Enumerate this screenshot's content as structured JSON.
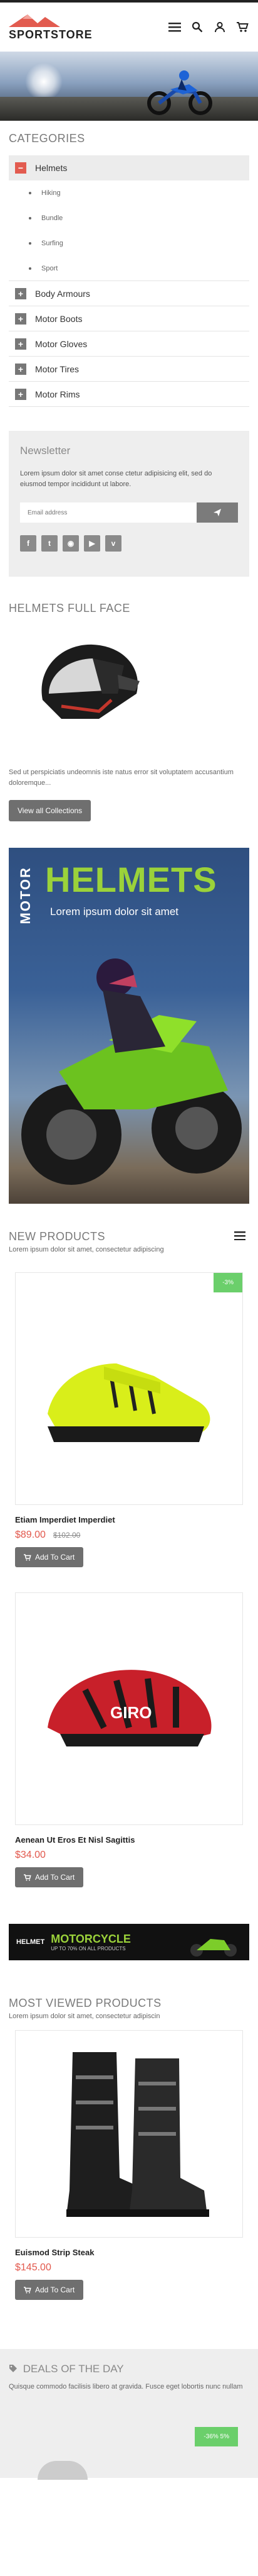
{
  "brand": {
    "name": "SPORTSTORE",
    "accent": "#e25b4f"
  },
  "header_icons": [
    "menu-icon",
    "search-icon",
    "user-icon",
    "cart-icon"
  ],
  "categories": {
    "title": "CATEGORIES",
    "active": {
      "label": "Helmets",
      "toggle": "−"
    },
    "subs": [
      "Hiking",
      "Bundle",
      "Surfing",
      "Sport"
    ],
    "items": [
      {
        "label": "Body Armours",
        "toggle": "+"
      },
      {
        "label": "Motor Boots",
        "toggle": "+"
      },
      {
        "label": "Motor Gloves",
        "toggle": "+"
      },
      {
        "label": "Motor Tires",
        "toggle": "+"
      },
      {
        "label": "Motor Rims",
        "toggle": "+"
      }
    ]
  },
  "newsletter": {
    "title": "Newsletter",
    "text": "Lorem ipsum dolor sit amet conse ctetur adipisicing elit, sed do eiusmod tempor incididunt ut labore.",
    "placeholder": "Email address",
    "social": [
      "facebook-icon",
      "twitter-icon",
      "rss-icon",
      "youtube-icon",
      "vimeo-icon"
    ]
  },
  "helmets_full_face": {
    "title": "HELMETS FULL FACE",
    "text": "Sed ut perspiciatis undeomnis iste natus error sit voluptatem accusantium doloremque...",
    "button": "View all Collections"
  },
  "banner": {
    "vertical": "MOTOR",
    "headline": "HELMETS",
    "tagline": "Lorem ipsum dolor sit amet"
  },
  "new_products": {
    "title": "NEW PRODUCTS",
    "subtitle": "Lorem ipsum dolor sit amet, consectetur adipiscing",
    "items": [
      {
        "name": "Etiam Imperdiet Imperdiet",
        "price": "$89.00",
        "old_price": "$102.00",
        "badge": "-3%",
        "cart": "Add To Cart"
      },
      {
        "name": "Aenean Ut Eros Et Nisl Sagittis",
        "price": "$34.00",
        "old_price": "",
        "badge": "",
        "cart": "Add To Cart"
      }
    ]
  },
  "strip": {
    "a": "HELMET",
    "b": "MOTORCYCLE",
    "c": "UP TO 70% ON ALL PRODUCTS"
  },
  "most_viewed": {
    "title": "MOST VIEWED PRODUCTS",
    "subtitle": "Lorem ipsum dolor sit amet, consectetur adipiscin",
    "items": [
      {
        "name": "Euismod Strip Steak",
        "price": "$145.00",
        "cart": "Add To Cart"
      }
    ]
  },
  "deals": {
    "title": "DEALS OF THE DAY",
    "text": "Quisque commodo facilisis libero at gravida. Fusce eget lobortis nunc nullam",
    "badge": "-36% 5%"
  }
}
